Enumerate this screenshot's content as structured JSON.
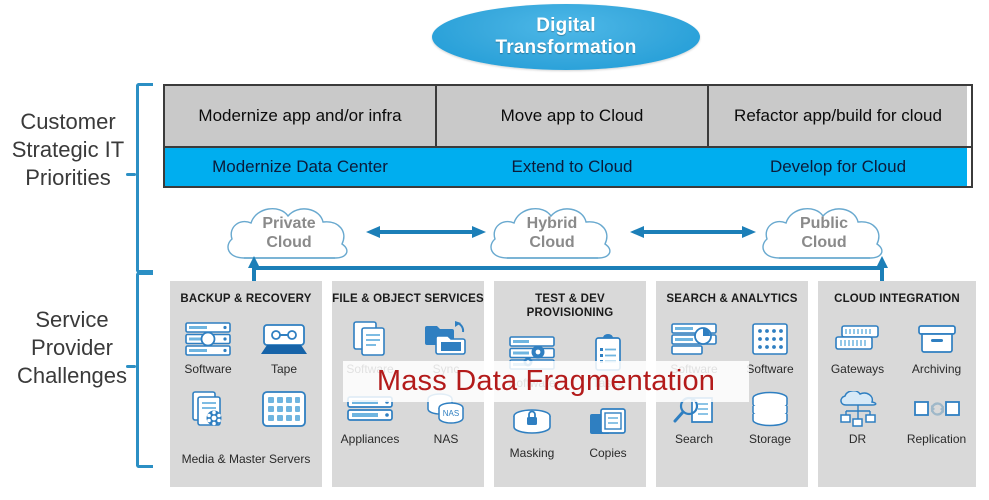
{
  "title": {
    "line1": "Digital",
    "line2": "Transformation"
  },
  "side_labels": {
    "strategic": "Customer Strategic IT Priorities",
    "service": "Service Provider Challenges"
  },
  "matrix": {
    "gray_row": [
      "Modernize app and/or infra",
      "Move app to Cloud",
      "Refactor app/build for cloud"
    ],
    "blue_row": [
      "Modernize Data Center",
      "Extend to Cloud",
      "Develop for Cloud"
    ]
  },
  "clouds": [
    {
      "name": "private-cloud",
      "line1": "Private",
      "line2": "Cloud"
    },
    {
      "name": "hybrid-cloud",
      "line1": "Hybrid",
      "line2": "Cloud"
    },
    {
      "name": "public-cloud",
      "line1": "Public",
      "line2": "Cloud"
    }
  ],
  "panels": [
    {
      "title": "BACKUP & RECOVERY",
      "items": [
        {
          "label": "Software",
          "icon": "server-rack-icon"
        },
        {
          "label": "Tape",
          "icon": "tape-drive-icon"
        }
      ],
      "bottom_items": [
        {
          "label": "",
          "icon": "media-server-icon"
        },
        {
          "label": "",
          "icon": "master-server-icon"
        }
      ],
      "span_label": "Media & Master Servers"
    },
    {
      "title": "FILE & OBJECT SERVICES",
      "items": [
        {
          "label": "Software",
          "icon": "documents-icon"
        },
        {
          "label": "Sync",
          "icon": "file-sync-icon"
        }
      ],
      "bottom_items": [
        {
          "label": "Appliances",
          "icon": "appliance-icon"
        },
        {
          "label": "NAS",
          "icon": "nas-disk-icon"
        }
      ],
      "span_label": ""
    },
    {
      "title": "TEST & DEV PROVISIONING",
      "items": [
        {
          "label": "Software",
          "icon": "server-gear-icon"
        },
        {
          "label": "Tasks",
          "icon": "clipboard-icon"
        }
      ],
      "bottom_items": [
        {
          "label": "Masking",
          "icon": "masking-icon"
        },
        {
          "label": "Copies",
          "icon": "copies-icon"
        }
      ],
      "span_label": ""
    },
    {
      "title": "SEARCH & ANALYTICS",
      "items": [
        {
          "label": "Software",
          "icon": "server-analytics-icon"
        },
        {
          "label": "Software",
          "icon": "data-matrix-icon"
        }
      ],
      "bottom_items": [
        {
          "label": "Search",
          "icon": "search-book-icon"
        },
        {
          "label": "Storage",
          "icon": "storage-disks-icon"
        }
      ],
      "span_label": ""
    },
    {
      "title": "CLOUD INTEGRATION",
      "items": [
        {
          "label": "Gateways",
          "icon": "gateway-icon"
        },
        {
          "label": "Archiving",
          "icon": "archive-box-icon"
        }
      ],
      "bottom_items": [
        {
          "label": "DR",
          "icon": "cloud-dr-icon"
        },
        {
          "label": "Replication",
          "icon": "replication-icon"
        }
      ],
      "span_label": ""
    }
  ],
  "overlay": {
    "text": "Mass Data Fragmentation"
  },
  "colors": {
    "title_blue": "#1c9ad6",
    "row_blue": "#00aeef",
    "row_gray": "#c9c9c9",
    "panel_gray": "#d9d9d9",
    "bracket_blue": "#2b8fc4",
    "arrow_blue": "#1c7fb8",
    "overlay_red": "#b31b1b",
    "icon_blue": "#2f7fc1"
  }
}
